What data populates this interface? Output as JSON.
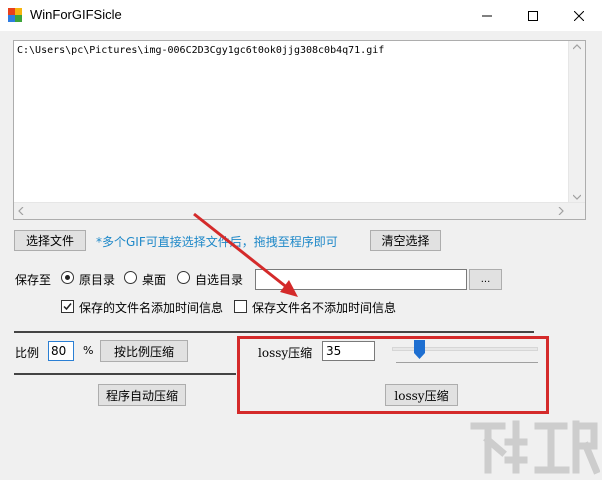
{
  "window": {
    "title": "WinForGIFSicle",
    "icon": "app-icon",
    "controls": [
      "minimize-icon",
      "maximize-icon",
      "close-icon"
    ]
  },
  "file_list": {
    "items": [
      "C:\\Users\\pc\\Pictures\\img-006C2D3Cgy1gc6t0ok0jjg308c0b4q71.gif"
    ]
  },
  "toolbar": {
    "select_file": "选择文件",
    "hint": "*多个GIF可直接选择文件后，拖拽至程序即可",
    "clear_selection": "清空选择"
  },
  "save": {
    "label": "保存至",
    "options": [
      "原目录",
      "桌面",
      "自选目录"
    ],
    "selected": "原目录",
    "dir_path": "",
    "browse": "...",
    "add_time": "保存的文件名添加时间信息",
    "no_time": "保存文件名不添加时间信息",
    "add_time_checked": true,
    "no_time_checked": false
  },
  "ratio": {
    "label": "比例",
    "value": "80",
    "unit": "%",
    "button": "按比例压缩",
    "auto_button": "程序自动压缩"
  },
  "lossy": {
    "label": "lossy压缩",
    "value": "35",
    "slider_value": 35,
    "button": "lossy压缩"
  },
  "annotation": {
    "highlight_color": "#d42a2a"
  },
  "watermark": "下载吧"
}
